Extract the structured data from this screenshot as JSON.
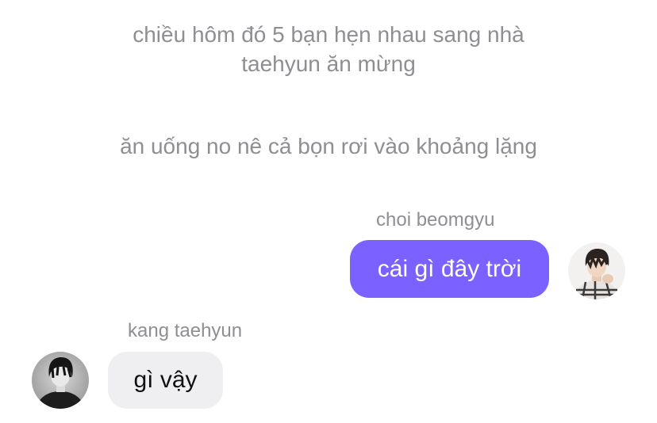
{
  "narration": {
    "line1a": "chiều hôm đó 5 bạn hẹn nhau sang nhà",
    "line1b": "taehyun ăn mừng",
    "line2": "ăn uống no nê cả bọn rơi vào khoảng lặng"
  },
  "messages": [
    {
      "sender": "choi beomgyu",
      "text": "cái gì đây trời",
      "side": "right",
      "bubble_color": "#7b61ff"
    },
    {
      "sender": "kang taehyun",
      "text": "gì vậy",
      "side": "left",
      "bubble_color": "#efeff1"
    }
  ],
  "colors": {
    "narration_text": "#8e8e93",
    "sender_name": "#8e8e93",
    "accent": "#7b61ff",
    "background": "#ffffff"
  }
}
